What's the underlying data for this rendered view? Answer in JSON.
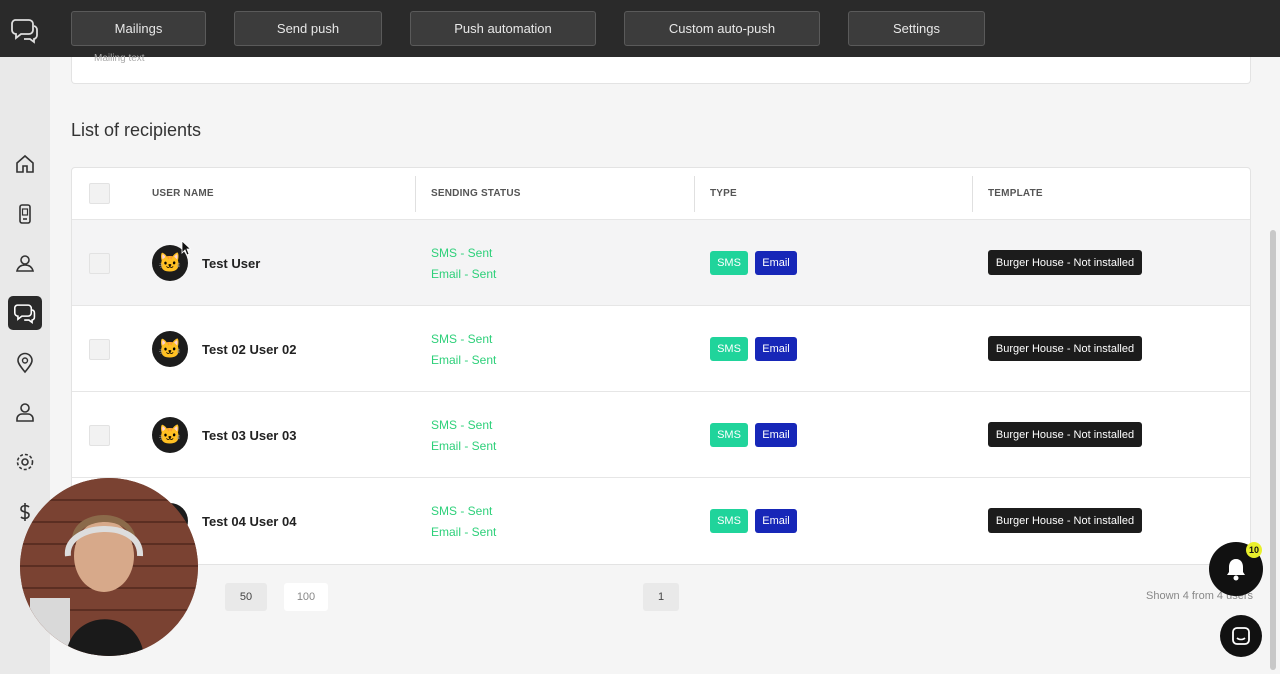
{
  "topnav": {
    "items": [
      {
        "label": "Mailings"
      },
      {
        "label": "Send push"
      },
      {
        "label": "Push automation"
      },
      {
        "label": "Custom auto-push"
      },
      {
        "label": "Settings"
      }
    ]
  },
  "sidebar": {
    "items": [
      {
        "icon": "home-icon"
      },
      {
        "icon": "phone-icon"
      },
      {
        "icon": "users-icon"
      },
      {
        "icon": "chat-icon",
        "active": true
      },
      {
        "icon": "location-pin-icon"
      },
      {
        "icon": "user-icon"
      },
      {
        "icon": "gear-icon"
      },
      {
        "icon": "dollar-icon"
      }
    ]
  },
  "mailing_card": {
    "label": "Mailing text"
  },
  "recipients": {
    "title": "List of recipients",
    "columns": {
      "user_name": "USER NAME",
      "sending_status": "SENDING STATUS",
      "type": "TYPE",
      "template": "TEMPLATE"
    },
    "rows": [
      {
        "name": "Test User",
        "sms_status": "SMS - Sent",
        "email_status": "Email - Sent",
        "type_sms": "SMS",
        "type_email": "Email",
        "template": "Burger House - Not installed"
      },
      {
        "name": "Test 02 User 02",
        "sms_status": "SMS - Sent",
        "email_status": "Email - Sent",
        "type_sms": "SMS",
        "type_email": "Email",
        "template": "Burger House - Not installed"
      },
      {
        "name": "Test 03 User 03",
        "sms_status": "SMS - Sent",
        "email_status": "Email - Sent",
        "type_sms": "SMS",
        "type_email": "Email",
        "template": "Burger House - Not installed"
      },
      {
        "name": "Test 04 User 04",
        "sms_status": "SMS - Sent",
        "email_status": "Email - Sent",
        "type_sms": "SMS",
        "type_email": "Email",
        "template": "Burger House - Not installed"
      }
    ]
  },
  "pagination": {
    "page_sizes": [
      "50",
      "100"
    ],
    "current_page": "1",
    "shown": "Shown 4 from 4 users"
  },
  "notifications": {
    "count": "10"
  },
  "colors": {
    "status_sent": "#2ed07a",
    "sms_tag": "#20d49b",
    "email_tag": "#1727b8",
    "topbar": "#2a2a2a"
  }
}
